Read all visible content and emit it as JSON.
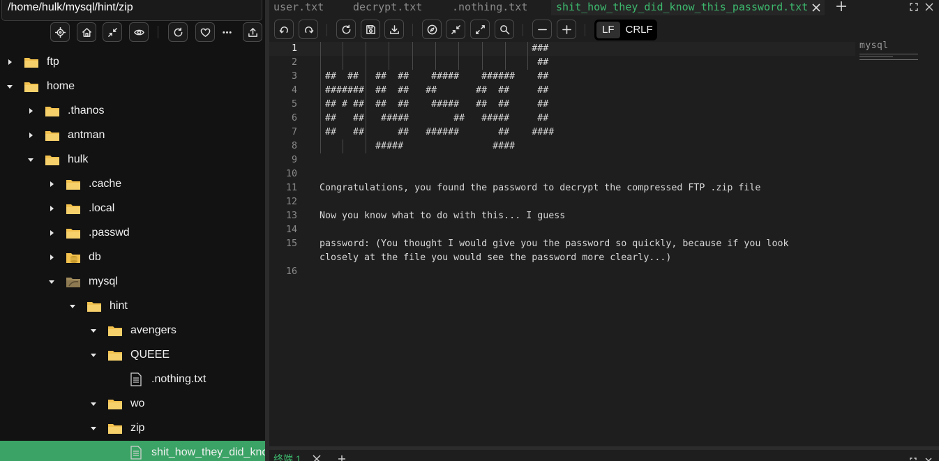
{
  "path": "/home/hulk/mysql/hint/zip",
  "tree": [
    {
      "label": "ftp",
      "expanded": false,
      "icon": "folder"
    },
    {
      "label": "home",
      "expanded": true,
      "icon": "folder"
    },
    {
      "label": ".thanos",
      "expanded": false,
      "icon": "folder"
    },
    {
      "label": "antman",
      "expanded": false,
      "icon": "folder"
    },
    {
      "label": "hulk",
      "expanded": true,
      "icon": "folder"
    },
    {
      "label": ".cache",
      "expanded": false,
      "icon": "folder"
    },
    {
      "label": ".local",
      "expanded": false,
      "icon": "folder"
    },
    {
      "label": ".passwd",
      "expanded": false,
      "icon": "folder"
    },
    {
      "label": "db",
      "expanded": false,
      "icon": "database-folder"
    },
    {
      "label": "mysql",
      "expanded": true,
      "icon": "mysql-folder"
    },
    {
      "label": "hint",
      "expanded": true,
      "icon": "folder"
    },
    {
      "label": "avengers",
      "expanded": true,
      "icon": "folder"
    },
    {
      "label": "QUEEE",
      "expanded": true,
      "icon": "folder"
    },
    {
      "label": ".nothing.txt",
      "icon": "file"
    },
    {
      "label": "wo",
      "expanded": true,
      "icon": "folder"
    },
    {
      "label": "zip",
      "expanded": true,
      "icon": "folder"
    },
    {
      "label": "shit_how_they_did_know_this_password.txt",
      "icon": "file",
      "selected": true
    }
  ],
  "tabs": [
    {
      "label": "user.txt",
      "active": false
    },
    {
      "label": "decrypt.txt",
      "active": false
    },
    {
      "label": ".nothing.txt",
      "active": false
    },
    {
      "label": "shit_how_they_did_know_this_password.txt",
      "active": true
    }
  ],
  "eol": {
    "lf": "LF",
    "crlf": "CRLF",
    "selected": "LF"
  },
  "current_line": 1,
  "code_lines": [
    {
      "n": "1",
      "text": "                                      ###"
    },
    {
      "n": "2",
      "text": "                                       ##"
    },
    {
      "n": "3",
      "text": " ##  ##   ##  ##    #####    ######    ##"
    },
    {
      "n": "4",
      "text": " #######  ##  ##   ##       ##  ##     ##"
    },
    {
      "n": "5",
      "text": " ## # ##  ##  ##    #####   ##  ##     ##"
    },
    {
      "n": "6",
      "text": " ##   ##   #####        ##   #####     ##"
    },
    {
      "n": "7",
      "text": " ##   ##      ##   ######       ##    ####"
    },
    {
      "n": "8",
      "text": "          #####                ####"
    },
    {
      "n": "9",
      "text": ""
    },
    {
      "n": "10",
      "text": ""
    },
    {
      "n": "11",
      "text": "Congratulations, you found the password to decrypt the compressed FTP .zip file"
    },
    {
      "n": "12",
      "text": ""
    },
    {
      "n": "13",
      "text": "Now you know what to do with this... I guess"
    },
    {
      "n": "14",
      "text": ""
    },
    {
      "n": "15",
      "text": "password: (You thought I would give you the password so quickly, because if you look"
    },
    {
      "n": "",
      "text": "closely at the file you would see the password more clearly...)"
    },
    {
      "n": "16",
      "text": ""
    }
  ],
  "minimap": {
    "title": "mysql"
  },
  "terminal": {
    "tab_label": "终端 1"
  },
  "colors": {
    "accent": "#3dba6e",
    "selection": "#3aa365",
    "folder": "#f2c14e"
  }
}
